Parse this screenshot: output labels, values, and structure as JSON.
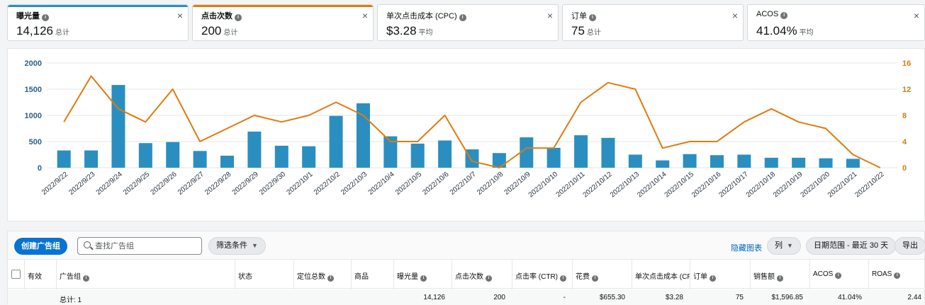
{
  "metrics": [
    {
      "label": "曝光量",
      "value": "14,126",
      "unit": "总计",
      "color": "#2a8fc0"
    },
    {
      "label": "点击次数",
      "value": "200",
      "unit": "总计",
      "color": "#e07b0d"
    },
    {
      "label": "单次点击成本 (CPC)",
      "value": "$3.28",
      "unit": "平均",
      "color": ""
    },
    {
      "label": "订单",
      "value": "75",
      "unit": "总计",
      "color": ""
    },
    {
      "label": "ACOS",
      "value": "41.04%",
      "unit": "平均",
      "color": ""
    }
  ],
  "close_glyph": "×",
  "chart_data": {
    "type": "bar+line",
    "categories": [
      "2022/9/22",
      "2022/9/23",
      "2022/9/24",
      "2022/9/25",
      "2022/9/26",
      "2022/9/27",
      "2022/9/28",
      "2022/9/29",
      "2022/9/30",
      "2022/10/1",
      "2022/10/2",
      "2022/10/3",
      "2022/10/4",
      "2022/10/5",
      "2022/10/6",
      "2022/10/7",
      "2022/10/8",
      "2022/10/9",
      "2022/10/10",
      "2022/10/11",
      "2022/10/12",
      "2022/10/13",
      "2022/10/14",
      "2022/10/15",
      "2022/10/16",
      "2022/10/17",
      "2022/10/18",
      "2022/10/19",
      "2022/10/20",
      "2022/10/21",
      "2022/10/22"
    ],
    "series": [
      {
        "axis": "left",
        "kind": "bar",
        "color": "#2a8fc0",
        "values": [
          330,
          330,
          1580,
          470,
          490,
          320,
          230,
          690,
          420,
          410,
          990,
          1230,
          600,
          460,
          520,
          350,
          280,
          580,
          380,
          620,
          570,
          250,
          140,
          260,
          240,
          250,
          190,
          190,
          180,
          170,
          0
        ]
      },
      {
        "axis": "right",
        "kind": "line",
        "color": "#e07b0d",
        "values": [
          7,
          14,
          9,
          7,
          12,
          4,
          6,
          8,
          7,
          8,
          10,
          8,
          4,
          4,
          8,
          1,
          0,
          3,
          3,
          10,
          13,
          12,
          3,
          4,
          4,
          7,
          9,
          7,
          6,
          2,
          0
        ]
      }
    ],
    "left_axis": {
      "ticks": [
        "0",
        "500",
        "1000",
        "1500",
        "2000"
      ],
      "max": 2000
    },
    "right_axis": {
      "ticks": [
        "0",
        "4",
        "8",
        "12",
        "16"
      ],
      "max": 16
    }
  },
  "toolbar": {
    "create_label": "创建广告组",
    "search_placeholder": "查找广告组",
    "filter_label": "筛选条件",
    "hide_chart_label": "隐藏图表",
    "columns_label": "列",
    "date_range_label": "日期范围 - 最近 30 天",
    "export_label": "导出"
  },
  "table": {
    "headers": [
      "有效",
      "广告组",
      "状态",
      "定位总数",
      "商品",
      "曝光量",
      "点击次数",
      "点击率 (CTR)",
      "花费",
      "单次点击成本 (CPC)",
      "订单",
      "销售额",
      "ACOS",
      "ROAS"
    ],
    "total_row": {
      "label": "总计: 1",
      "impressions": "14,126",
      "clicks": "200",
      "ctr": "-",
      "spend": "$655.30",
      "cpc": "$3.28",
      "orders": "75",
      "sales": "$1,596.85",
      "acos": "41.04%",
      "roas": "2.44"
    }
  }
}
